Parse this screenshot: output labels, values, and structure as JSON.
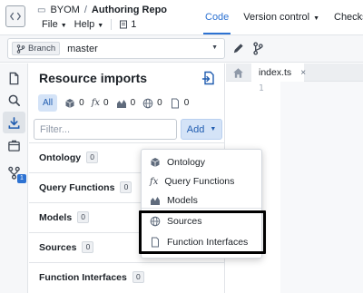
{
  "header": {
    "app_icon": "code-brackets-icon",
    "folder": "BYOM",
    "separator": "/",
    "repo_title": "Authoring Repo",
    "menus": [
      {
        "label": "File"
      },
      {
        "label": "Help"
      }
    ],
    "file_count": "1",
    "nav_tabs": [
      {
        "label": "Code",
        "active": true
      },
      {
        "label": "Version control",
        "active": false
      },
      {
        "label": "Checks",
        "active": false
      }
    ]
  },
  "branch_bar": {
    "tag_label": "Branch",
    "branch": "master"
  },
  "rail": {
    "badge": "1"
  },
  "panel": {
    "title": "Resource imports",
    "filters": [
      {
        "key": "all",
        "label": "All"
      },
      {
        "key": "ontology",
        "icon": "cube-icon",
        "count": "0"
      },
      {
        "key": "functions",
        "icon": "fx-icon",
        "glyph": "fx",
        "count": "0"
      },
      {
        "key": "models",
        "icon": "model-icon",
        "count": "0"
      },
      {
        "key": "sources",
        "icon": "globe-icon",
        "count": "0"
      },
      {
        "key": "interfaces",
        "icon": "document-icon",
        "count": "0"
      }
    ],
    "filter_placeholder": "Filter...",
    "add_label": "Add",
    "sections": [
      {
        "label": "Ontology",
        "count": "0"
      },
      {
        "label": "Query Functions",
        "count": "0"
      },
      {
        "label": "Models",
        "count": "0"
      },
      {
        "label": "Sources",
        "count": "0"
      },
      {
        "label": "Function Interfaces",
        "count": "0"
      }
    ]
  },
  "editor": {
    "tab_label": "index.ts",
    "close_glyph": "×",
    "line_number": "1"
  },
  "add_menu": {
    "items": [
      {
        "label": "Ontology",
        "icon": "cube-icon"
      },
      {
        "label": "Query Functions",
        "icon": "fx-icon",
        "glyph": "fx"
      },
      {
        "label": "Models",
        "icon": "model-icon"
      },
      {
        "label": "Sources",
        "icon": "globe-icon"
      },
      {
        "label": "Function Interfaces",
        "icon": "document-icon"
      }
    ]
  },
  "colors": {
    "accent": "#2d72d2",
    "chip_bg": "#d4e3f7",
    "highlight_border": "#000000"
  }
}
